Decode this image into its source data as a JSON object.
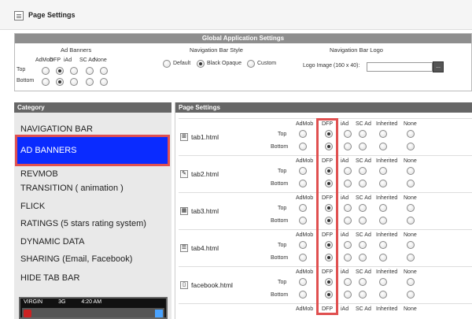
{
  "page_title": "Page Settings",
  "global": {
    "header": "Global Application Settings",
    "ad_banners": {
      "title": "Ad Banners",
      "columns": [
        "AdMob",
        "DFP",
        "iAd",
        "SC Ad",
        "None"
      ],
      "rows": [
        {
          "label": "Top",
          "selected": "DFP"
        },
        {
          "label": "Bottom",
          "selected": "DFP"
        }
      ]
    },
    "nav_style": {
      "title": "Navigation Bar Style",
      "options": [
        "Default",
        "Black Opaque",
        "Custom"
      ],
      "selected": "Black Opaque"
    },
    "nav_logo": {
      "title": "Navigation Bar Logo",
      "label": "Logo Image (160 x 40):",
      "value": "",
      "browse": "..."
    }
  },
  "category": {
    "header": "Category",
    "items": [
      "NAVIGATION BAR",
      "AD BANNERS",
      "REVMOB",
      "TRANSITION ( animation )",
      "FLICK",
      "RATINGS (5 stars rating system)",
      "DYNAMIC DATA",
      "SHARING (Email, Facebook)",
      "HIDE TAB BAR"
    ],
    "active": "AD BANNERS",
    "phone": {
      "carrier": "VIRGIN",
      "network": "3G",
      "time": "4:20 AM"
    }
  },
  "settings": {
    "header": "Page Settings",
    "columns": [
      "AdMob",
      "DFP",
      "iAd",
      "SC Ad",
      "Inherited",
      "None"
    ],
    "positions": [
      "Top",
      "Bottom"
    ],
    "tabs": [
      {
        "name": "tab1.html",
        "top": "DFP",
        "bottom": "DFP",
        "icon": "grid-icon"
      },
      {
        "name": "tab2.html",
        "top": "DFP",
        "bottom": "DFP",
        "icon": "pencil-icon"
      },
      {
        "name": "tab3.html",
        "top": "DFP",
        "bottom": "DFP",
        "icon": "chart-icon"
      },
      {
        "name": "tab4.html",
        "top": "DFP",
        "bottom": "DFP",
        "icon": "list-icon"
      },
      {
        "name": "facebook.html",
        "top": "DFP",
        "bottom": "DFP",
        "icon": "phone-icon"
      }
    ],
    "trailing_header": [
      "AdMob",
      "DFP",
      "iAd",
      "SC Ad",
      "Inherited",
      "None"
    ]
  },
  "colors": {
    "highlight": "#e05050",
    "active_category": "#0a2bff",
    "header_bg": "#666666"
  }
}
